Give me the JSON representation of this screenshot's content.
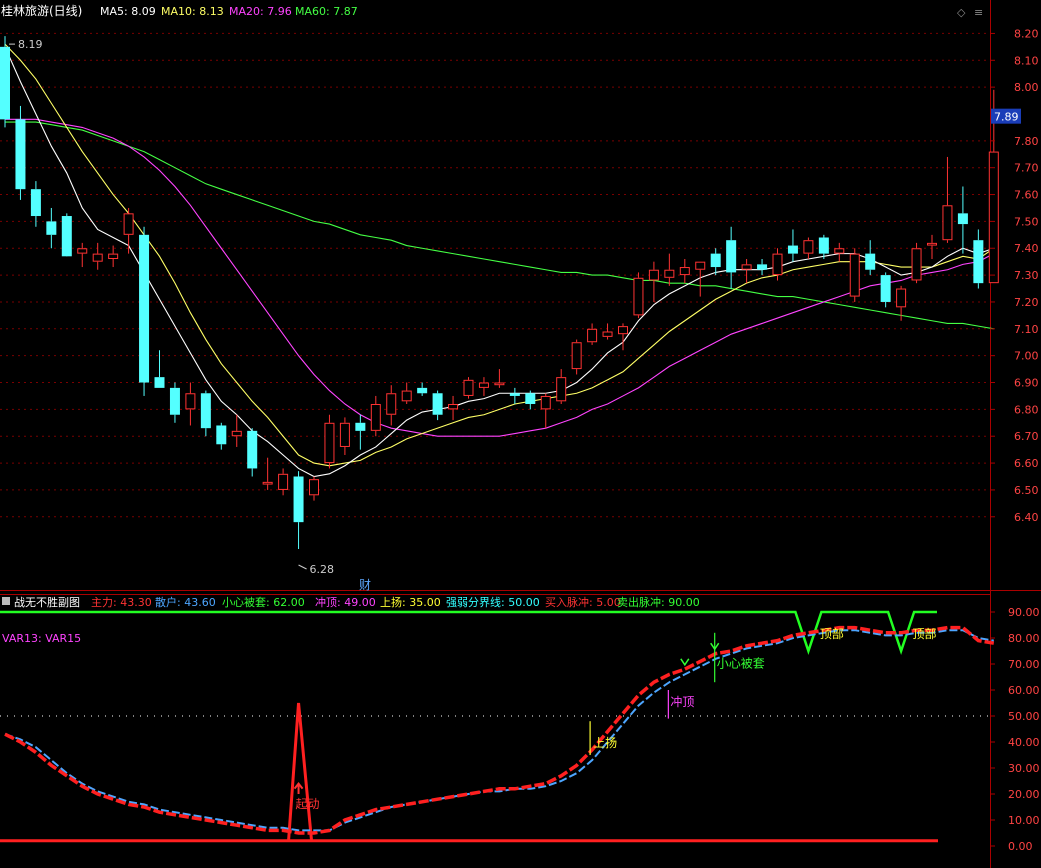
{
  "header": {
    "title": "桂林旅游(日线)",
    "ma_items": [
      {
        "label": "MA5: 8.09",
        "color": "#ffffff"
      },
      {
        "label": "MA10: 8.13",
        "color": "#ffff66"
      },
      {
        "label": "MA20: 7.96",
        "color": "#ff44ff"
      },
      {
        "label": "MA60: 7.87",
        "color": "#44ff44"
      }
    ]
  },
  "sub_header": {
    "title": "战无不胜副图",
    "items": [
      {
        "label": "主力: 43.30",
        "color": "#ff3333"
      },
      {
        "label": "散户: 43.60",
        "color": "#4da6ff"
      },
      {
        "label": "小心被套: 62.00",
        "color": "#33ff33"
      },
      {
        "label": "冲顶: 49.00",
        "color": "#ff44ff"
      },
      {
        "label": "上扬: 35.00",
        "color": "#ffff33"
      },
      {
        "label": "强弱分界线: 50.00",
        "color": "#33ffff"
      },
      {
        "label": "买入脉冲: 5.00",
        "color": "#ff3333"
      },
      {
        "label": "卖出脉冲: 90.00",
        "color": "#33ff33"
      }
    ],
    "var_label": "VAR13: VAR15"
  },
  "chart_data": [
    {
      "type": "candlestick",
      "title": "桂林旅游(日线)",
      "ylim": [
        6.28,
        8.25
      ],
      "yticks": [
        "8.20",
        "8.10",
        "8.00",
        "7.80",
        "7.70",
        "7.60",
        "7.50",
        "7.40",
        "7.30",
        "7.20",
        "7.10",
        "7.00",
        "6.90",
        "6.80",
        "6.70",
        "6.60",
        "6.50",
        "6.40"
      ],
      "current_price": "7.89",
      "high_label": "8.19",
      "low_label": "6.28",
      "event_marker": "财",
      "colors": {
        "up": "#ff3333",
        "down": "#54ffff",
        "ma5": "#ffffff",
        "ma10": "#ffff66",
        "ma20": "#ff44ff",
        "ma60": "#44ff44"
      },
      "candles": [
        {
          "o": 8.15,
          "h": 8.19,
          "l": 7.85,
          "c": 7.88
        },
        {
          "o": 7.88,
          "h": 7.93,
          "l": 7.58,
          "c": 7.62
        },
        {
          "o": 7.62,
          "h": 7.65,
          "l": 7.48,
          "c": 7.52
        },
        {
          "o": 7.5,
          "h": 7.55,
          "l": 7.4,
          "c": 7.45
        },
        {
          "o": 7.52,
          "h": 7.53,
          "l": 7.38,
          "c": 7.37
        },
        {
          "o": 7.38,
          "h": 7.42,
          "l": 7.33,
          "c": 7.4
        },
        {
          "o": 7.35,
          "h": 7.42,
          "l": 7.32,
          "c": 7.38
        },
        {
          "o": 7.36,
          "h": 7.41,
          "l": 7.33,
          "c": 7.38
        },
        {
          "o": 7.45,
          "h": 7.55,
          "l": 7.38,
          "c": 7.53
        },
        {
          "o": 7.45,
          "h": 7.48,
          "l": 6.85,
          "c": 6.9
        },
        {
          "o": 6.92,
          "h": 7.02,
          "l": 6.88,
          "c": 6.88
        },
        {
          "o": 6.88,
          "h": 6.9,
          "l": 6.75,
          "c": 6.78
        },
        {
          "o": 6.8,
          "h": 6.9,
          "l": 6.74,
          "c": 6.86
        },
        {
          "o": 6.86,
          "h": 6.87,
          "l": 6.7,
          "c": 6.73
        },
        {
          "o": 6.74,
          "h": 6.75,
          "l": 6.65,
          "c": 6.67
        },
        {
          "o": 6.7,
          "h": 6.78,
          "l": 6.66,
          "c": 6.72
        },
        {
          "o": 6.72,
          "h": 6.73,
          "l": 6.55,
          "c": 6.58
        },
        {
          "o": 6.52,
          "h": 6.62,
          "l": 6.5,
          "c": 6.53
        },
        {
          "o": 6.5,
          "h": 6.58,
          "l": 6.48,
          "c": 6.56
        },
        {
          "o": 6.55,
          "h": 6.57,
          "l": 6.28,
          "c": 6.38
        },
        {
          "o": 6.48,
          "h": 6.55,
          "l": 6.46,
          "c": 6.54
        },
        {
          "o": 6.6,
          "h": 6.78,
          "l": 6.58,
          "c": 6.75
        },
        {
          "o": 6.66,
          "h": 6.77,
          "l": 6.63,
          "c": 6.75
        },
        {
          "o": 6.75,
          "h": 6.78,
          "l": 6.65,
          "c": 6.72
        },
        {
          "o": 6.72,
          "h": 6.85,
          "l": 6.7,
          "c": 6.82
        },
        {
          "o": 6.78,
          "h": 6.89,
          "l": 6.74,
          "c": 6.86
        },
        {
          "o": 6.83,
          "h": 6.9,
          "l": 6.82,
          "c": 6.87
        },
        {
          "o": 6.88,
          "h": 6.9,
          "l": 6.85,
          "c": 6.86
        },
        {
          "o": 6.86,
          "h": 6.87,
          "l": 6.76,
          "c": 6.78
        },
        {
          "o": 6.8,
          "h": 6.85,
          "l": 6.76,
          "c": 6.82
        },
        {
          "o": 6.85,
          "h": 6.92,
          "l": 6.84,
          "c": 6.91
        },
        {
          "o": 6.88,
          "h": 6.92,
          "l": 6.85,
          "c": 6.9
        },
        {
          "o": 6.89,
          "h": 6.95,
          "l": 6.88,
          "c": 6.9
        },
        {
          "o": 6.86,
          "h": 6.88,
          "l": 6.82,
          "c": 6.85
        },
        {
          "o": 6.86,
          "h": 6.87,
          "l": 6.8,
          "c": 6.82
        },
        {
          "o": 6.8,
          "h": 6.86,
          "l": 6.73,
          "c": 6.85
        },
        {
          "o": 6.83,
          "h": 6.95,
          "l": 6.82,
          "c": 6.92
        },
        {
          "o": 6.95,
          "h": 7.06,
          "l": 6.93,
          "c": 7.05
        },
        {
          "o": 7.05,
          "h": 7.12,
          "l": 7.04,
          "c": 7.1
        },
        {
          "o": 7.07,
          "h": 7.12,
          "l": 7.06,
          "c": 7.09
        },
        {
          "o": 7.08,
          "h": 7.12,
          "l": 7.02,
          "c": 7.11
        },
        {
          "o": 7.15,
          "h": 7.31,
          "l": 7.14,
          "c": 7.29
        },
        {
          "o": 7.28,
          "h": 7.35,
          "l": 7.2,
          "c": 7.32
        },
        {
          "o": 7.29,
          "h": 7.38,
          "l": 7.26,
          "c": 7.32
        },
        {
          "o": 7.3,
          "h": 7.36,
          "l": 7.27,
          "c": 7.33
        },
        {
          "o": 7.32,
          "h": 7.35,
          "l": 7.22,
          "c": 7.35
        },
        {
          "o": 7.38,
          "h": 7.4,
          "l": 7.3,
          "c": 7.33
        },
        {
          "o": 7.43,
          "h": 7.48,
          "l": 7.25,
          "c": 7.31
        },
        {
          "o": 7.32,
          "h": 7.36,
          "l": 7.27,
          "c": 7.34
        },
        {
          "o": 7.34,
          "h": 7.36,
          "l": 7.3,
          "c": 7.32
        },
        {
          "o": 7.3,
          "h": 7.4,
          "l": 7.28,
          "c": 7.38
        },
        {
          "o": 7.41,
          "h": 7.47,
          "l": 7.35,
          "c": 7.38
        },
        {
          "o": 7.38,
          "h": 7.44,
          "l": 7.36,
          "c": 7.43
        },
        {
          "o": 7.44,
          "h": 7.45,
          "l": 7.36,
          "c": 7.38
        },
        {
          "o": 7.38,
          "h": 7.42,
          "l": 7.35,
          "c": 7.4
        },
        {
          "o": 7.22,
          "h": 7.4,
          "l": 7.2,
          "c": 7.38
        },
        {
          "o": 7.38,
          "h": 7.43,
          "l": 7.3,
          "c": 7.32
        },
        {
          "o": 7.3,
          "h": 7.31,
          "l": 7.18,
          "c": 7.2
        },
        {
          "o": 7.18,
          "h": 7.26,
          "l": 7.13,
          "c": 7.25
        },
        {
          "o": 7.28,
          "h": 7.42,
          "l": 7.27,
          "c": 7.4
        },
        {
          "o": 7.41,
          "h": 7.45,
          "l": 7.36,
          "c": 7.42
        },
        {
          "o": 7.43,
          "h": 7.74,
          "l": 7.42,
          "c": 7.56
        },
        {
          "o": 7.53,
          "h": 7.63,
          "l": 7.38,
          "c": 7.49
        },
        {
          "o": 7.43,
          "h": 7.47,
          "l": 7.25,
          "c": 7.27
        },
        {
          "o": 7.27,
          "h": 7.99,
          "l": 7.27,
          "c": 7.76
        }
      ],
      "ma5": [
        8.15,
        8.02,
        7.9,
        7.78,
        7.68,
        7.55,
        7.47,
        7.44,
        7.41,
        7.31,
        7.21,
        7.11,
        7.01,
        6.91,
        6.83,
        6.78,
        6.72,
        6.68,
        6.63,
        6.58,
        6.55,
        6.56,
        6.59,
        6.63,
        6.66,
        6.71,
        6.76,
        6.79,
        6.8,
        6.81,
        6.83,
        6.84,
        6.86,
        6.86,
        6.86,
        6.86,
        6.87,
        6.9,
        6.95,
        7.01,
        7.05,
        7.13,
        7.19,
        7.23,
        7.26,
        7.29,
        7.31,
        7.32,
        7.32,
        7.32,
        7.33,
        7.35,
        7.36,
        7.37,
        7.38,
        7.38,
        7.36,
        7.33,
        7.3,
        7.31,
        7.33,
        7.37,
        7.4,
        7.38,
        7.4
      ],
      "ma10": [
        8.16,
        8.1,
        8.03,
        7.94,
        7.85,
        7.76,
        7.68,
        7.6,
        7.53,
        7.45,
        7.37,
        7.27,
        7.16,
        7.06,
        6.97,
        6.9,
        6.83,
        6.77,
        6.7,
        6.63,
        6.6,
        6.59,
        6.6,
        6.61,
        6.64,
        6.66,
        6.69,
        6.71,
        6.73,
        6.75,
        6.77,
        6.78,
        6.8,
        6.82,
        6.83,
        6.84,
        6.85,
        6.86,
        6.88,
        6.91,
        6.94,
        6.99,
        7.04,
        7.09,
        7.13,
        7.17,
        7.21,
        7.24,
        7.27,
        7.29,
        7.3,
        7.32,
        7.33,
        7.34,
        7.35,
        7.35,
        7.35,
        7.34,
        7.33,
        7.33,
        7.33,
        7.35,
        7.37,
        7.36,
        7.4
      ],
      "ma20": [
        7.88,
        7.88,
        7.88,
        7.87,
        7.86,
        7.85,
        7.83,
        7.81,
        7.78,
        7.74,
        7.69,
        7.63,
        7.56,
        7.48,
        7.4,
        7.32,
        7.24,
        7.16,
        7.08,
        7.0,
        6.93,
        6.87,
        6.82,
        6.78,
        6.75,
        6.73,
        6.72,
        6.71,
        6.7,
        6.7,
        6.7,
        6.7,
        6.7,
        6.71,
        6.72,
        6.73,
        6.75,
        6.77,
        6.8,
        6.82,
        6.85,
        6.88,
        6.92,
        6.96,
        6.99,
        7.02,
        7.05,
        7.08,
        7.1,
        7.12,
        7.14,
        7.16,
        7.18,
        7.2,
        7.22,
        7.24,
        7.26,
        7.27,
        7.28,
        7.3,
        7.31,
        7.32,
        7.34,
        7.35,
        7.38
      ],
      "ma60": [
        7.87,
        7.87,
        7.87,
        7.86,
        7.85,
        7.84,
        7.82,
        7.8,
        7.78,
        7.76,
        7.73,
        7.7,
        7.67,
        7.64,
        7.62,
        7.6,
        7.58,
        7.56,
        7.54,
        7.52,
        7.5,
        7.49,
        7.47,
        7.45,
        7.44,
        7.43,
        7.41,
        7.4,
        7.39,
        7.38,
        7.37,
        7.36,
        7.35,
        7.34,
        7.33,
        7.32,
        7.31,
        7.31,
        7.3,
        7.3,
        7.29,
        7.28,
        7.28,
        7.27,
        7.27,
        7.26,
        7.26,
        7.25,
        7.24,
        7.23,
        7.22,
        7.22,
        7.21,
        7.2,
        7.19,
        7.18,
        7.17,
        7.16,
        7.15,
        7.14,
        7.13,
        7.12,
        7.12,
        7.11,
        7.1
      ]
    },
    {
      "type": "line",
      "title": "战无不胜副图",
      "ylim": [
        0,
        95
      ],
      "yticks": [
        "90.00",
        "80.00",
        "70.00",
        "60.00",
        "50.00",
        "40.00",
        "30.00",
        "20.00",
        "10.00",
        "0.00"
      ],
      "dotted_level": 50,
      "series": [
        {
          "name": "主力",
          "color": "#ff2020",
          "values": [
            43,
            40,
            36,
            31,
            27,
            23,
            20,
            18,
            16,
            15,
            13,
            12,
            11,
            10,
            9,
            8,
            7,
            6,
            6,
            5,
            5,
            6,
            10,
            12,
            14,
            15,
            16,
            17,
            18,
            19,
            20,
            21,
            22,
            22,
            23,
            24,
            27,
            31,
            37,
            44,
            51,
            58,
            63,
            66,
            68,
            71,
            74,
            75,
            77,
            78,
            79,
            81,
            82,
            83,
            84,
            84,
            83,
            82,
            82,
            83,
            83,
            84,
            84,
            79,
            78
          ]
        },
        {
          "name": "散户",
          "color": "#4da6ff",
          "values": [
            43,
            41,
            38,
            33,
            28,
            24,
            21,
            19,
            17,
            16,
            14,
            13,
            12,
            11,
            10,
            9,
            8,
            7,
            7,
            6,
            6,
            6,
            9,
            11,
            13,
            15,
            16,
            17,
            18,
            19,
            20,
            21,
            21,
            22,
            22,
            23,
            25,
            28,
            33,
            40,
            47,
            54,
            59,
            63,
            66,
            69,
            72,
            74,
            76,
            77,
            78,
            80,
            81,
            82,
            83,
            83,
            82,
            81,
            81,
            82,
            82,
            83,
            83,
            80,
            79
          ]
        }
      ],
      "impulse": {
        "index": 19,
        "value": 55,
        "color": "#ff2020"
      },
      "base_level": 2,
      "sell_line": {
        "value": 90,
        "color": "#22ff22",
        "dips": [
          {
            "index": 52,
            "to": 75
          },
          {
            "index": 58,
            "to": 75
          }
        ]
      },
      "annotations": [
        {
          "text": "起动",
          "index": 19,
          "value": 17,
          "color": "#ff3333"
        },
        {
          "text": "上扬",
          "index": 38,
          "value": 38,
          "color": "#ffff33"
        },
        {
          "text": "冲顶",
          "index": 43,
          "value": 57,
          "color": "#ff44ff"
        },
        {
          "text": "小心被套",
          "index": 46,
          "value": 71,
          "color": "#33ff33"
        },
        {
          "text": "顶部",
          "index": 53,
          "value": 83,
          "color": "#ffff33"
        },
        {
          "text": "顶部",
          "index": 59,
          "value": 83,
          "color": "#ffff33"
        }
      ]
    }
  ]
}
